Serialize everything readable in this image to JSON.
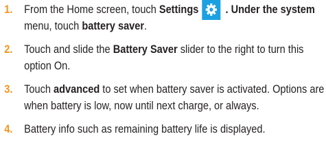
{
  "steps": [
    {
      "number": "1.",
      "parts": {
        "a": "From the Home screen, touch ",
        "b": "Settings",
        "icon": "gear-icon",
        "c": " . Under the ",
        "d": "system",
        "e": " menu, touch ",
        "f": "battery saver",
        "g": "."
      }
    },
    {
      "number": "2.",
      "parts": {
        "a": "Touch and slide the ",
        "b": "Battery Saver",
        "c": " slider to the right to turn this option On."
      }
    },
    {
      "number": "3.",
      "parts": {
        "a": "Touch ",
        "b": "advanced",
        "c": " to set when battery saver is activated. Options are when battery is low, now until next charge, or always."
      }
    },
    {
      "number": "4.",
      "parts": {
        "a": "Battery info such as remaining battery life is displayed."
      }
    }
  ],
  "colors": {
    "step_number": "#f7941d",
    "icon_background": "#1ba1e2",
    "text": "#231f20"
  }
}
